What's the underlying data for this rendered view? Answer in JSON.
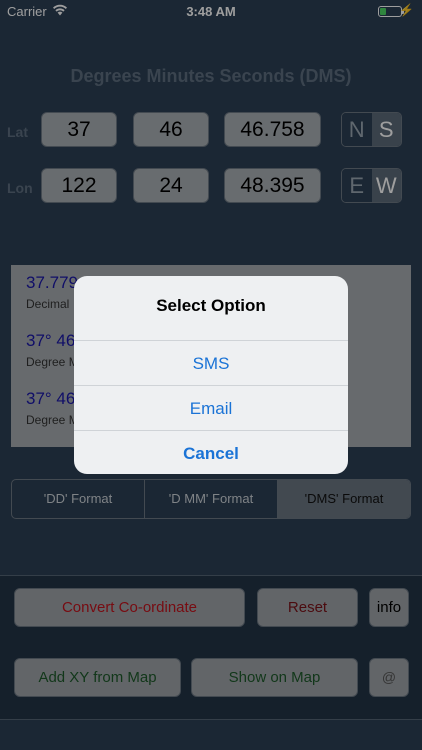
{
  "status": {
    "carrier": "Carrier",
    "time": "3:48 AM"
  },
  "title": "Degrees Minutes Seconds (DMS)",
  "lat": {
    "label": "Lat",
    "deg": "37",
    "min": "46",
    "sec": "46.758",
    "dir_a": "N",
    "dir_b": "S",
    "selected": "S"
  },
  "lon": {
    "label": "Lon",
    "deg": "122",
    "min": "24",
    "sec": "48.395",
    "dir_a": "E",
    "dir_b": "W",
    "selected": "E"
  },
  "results": [
    {
      "value": "37.779",
      "label": "Decimal"
    },
    {
      "value": "37° 46",
      "label": "Degree M"
    },
    {
      "value": "37° 46",
      "label": "Degree M"
    }
  ],
  "formats": [
    {
      "label": "'DD' Format",
      "active": false
    },
    {
      "label": "'D MM' Format",
      "active": false
    },
    {
      "label": "'DMS' Format",
      "active": true
    }
  ],
  "buttons": {
    "convert": "Convert Co-ordinate",
    "reset": "Reset",
    "info": "info",
    "add_xy": "Add XY from Map",
    "show_map": "Show on Map",
    "at": "@"
  },
  "dialog": {
    "title": "Select Option",
    "options": [
      "SMS",
      "Email",
      "Cancel"
    ]
  },
  "colors": {
    "convert_text": "#c0141e",
    "map_text": "#1d5a2a",
    "link_blue": "#1a73d6"
  }
}
